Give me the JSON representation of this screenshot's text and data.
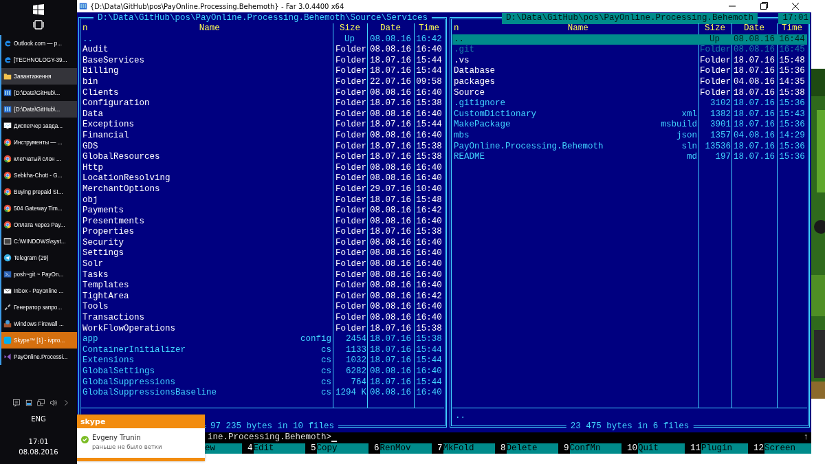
{
  "taskbar": {
    "items": [
      {
        "label": "Outlook.com — p...",
        "kind": "edge",
        "selected": false,
        "attention": false
      },
      {
        "label": "[TECHNOLOGY-39...",
        "kind": "edge",
        "selected": false,
        "attention": false
      },
      {
        "label": "Завантаження",
        "kind": "folder",
        "selected": true,
        "attention": false
      },
      {
        "label": "{D:\\Data\\GitHub\\...",
        "kind": "far",
        "selected": false,
        "attention": false
      },
      {
        "label": "{D:\\Data\\GitHub\\...",
        "kind": "far",
        "selected": true,
        "attention": false
      },
      {
        "label": "Диспетчер завда...",
        "kind": "monitor",
        "selected": false,
        "attention": false
      },
      {
        "label": "Инструменты — ...",
        "kind": "chrome",
        "selected": false,
        "attention": false
      },
      {
        "label": "клетчатый слон ...",
        "kind": "chrome",
        "selected": false,
        "attention": false
      },
      {
        "label": "Sebkha-Chott - G...",
        "kind": "chrome",
        "selected": false,
        "attention": false
      },
      {
        "label": "Buying prepaid SI...",
        "kind": "chrome",
        "selected": false,
        "attention": false
      },
      {
        "label": "504 Gateway Tim...",
        "kind": "chrome",
        "selected": false,
        "attention": false
      },
      {
        "label": "Оплата через Pay...",
        "kind": "chrome",
        "selected": false,
        "attention": false
      },
      {
        "label": "C:\\WINDOWS\\syst...",
        "kind": "cmd",
        "selected": false,
        "attention": false
      },
      {
        "label": "Telegram (29)",
        "kind": "telegram",
        "selected": false,
        "attention": false
      },
      {
        "label": "posh~git ~ PayOn...",
        "kind": "shell",
        "selected": false,
        "attention": false
      },
      {
        "label": "Inbox - Payonline ...",
        "kind": "mail",
        "selected": false,
        "attention": false
      },
      {
        "label": "Генератор запро...",
        "kind": "link",
        "selected": false,
        "attention": false
      },
      {
        "label": "Windows Firewall ...",
        "kind": "firewall",
        "selected": false,
        "attention": false
      },
      {
        "label": "Skype™ [1] - ivpro...",
        "kind": "skype",
        "selected": false,
        "attention": true
      },
      {
        "label": "PayOnline.Processi...",
        "kind": "vs",
        "selected": false,
        "attention": false
      }
    ],
    "tray": {
      "language": "ENG",
      "time": "17:01",
      "date": "08.08.2016"
    }
  },
  "window": {
    "title": "{D:\\Data\\GitHub\\pos\\PayOnline.Processing.Behemoth} - Far 3.0.4400 x64"
  },
  "panels": [
    {
      "active": false,
      "path": "D:\\Data\\GitHub\\pos\\PayOnline.Processing.Behemoth\\Source\\Services",
      "sort": "n",
      "columns": [
        "Name",
        "Size",
        "Date",
        "Time"
      ],
      "footer": "97 235 bytes in 10 files",
      "rows": [
        {
          "name": "..",
          "size": "Up",
          "date": "08.08.16",
          "time": "16:42",
          "kind": "up",
          "selected": false
        },
        {
          "name": "Audit",
          "size": "Folder",
          "date": "08.08.16",
          "time": "16:40",
          "kind": "folder",
          "selected": false
        },
        {
          "name": "BaseServices",
          "size": "Folder",
          "date": "18.07.16",
          "time": "15:44",
          "kind": "folder",
          "selected": false
        },
        {
          "name": "Billing",
          "size": "Folder",
          "date": "18.07.16",
          "time": "15:44",
          "kind": "folder",
          "selected": false
        },
        {
          "name": "bin",
          "size": "Folder",
          "date": "22.07.16",
          "time": "09:58",
          "kind": "folder",
          "selected": false
        },
        {
          "name": "Clients",
          "size": "Folder",
          "date": "08.08.16",
          "time": "16:40",
          "kind": "folder",
          "selected": false
        },
        {
          "name": "Configuration",
          "size": "Folder",
          "date": "18.07.16",
          "time": "15:38",
          "kind": "folder",
          "selected": false
        },
        {
          "name": "Data",
          "size": "Folder",
          "date": "08.08.16",
          "time": "16:40",
          "kind": "folder",
          "selected": false
        },
        {
          "name": "Exceptions",
          "size": "Folder",
          "date": "18.07.16",
          "time": "15:44",
          "kind": "folder",
          "selected": false
        },
        {
          "name": "Financial",
          "size": "Folder",
          "date": "08.08.16",
          "time": "16:40",
          "kind": "folder",
          "selected": false
        },
        {
          "name": "GDS",
          "size": "Folder",
          "date": "18.07.16",
          "time": "15:38",
          "kind": "folder",
          "selected": false
        },
        {
          "name": "GlobalResources",
          "size": "Folder",
          "date": "18.07.16",
          "time": "15:38",
          "kind": "folder",
          "selected": false
        },
        {
          "name": "Http",
          "size": "Folder",
          "date": "08.08.16",
          "time": "16:40",
          "kind": "folder",
          "selected": false
        },
        {
          "name": "LocationResolving",
          "size": "Folder",
          "date": "08.08.16",
          "time": "16:40",
          "kind": "folder",
          "selected": false
        },
        {
          "name": "MerchantOptions",
          "size": "Folder",
          "date": "29.07.16",
          "time": "10:40",
          "kind": "folder",
          "selected": false
        },
        {
          "name": "obj",
          "size": "Folder",
          "date": "18.07.16",
          "time": "15:48",
          "kind": "folder",
          "selected": false
        },
        {
          "name": "Payments",
          "size": "Folder",
          "date": "08.08.16",
          "time": "16:42",
          "kind": "folder",
          "selected": false
        },
        {
          "name": "Presentments",
          "size": "Folder",
          "date": "08.08.16",
          "time": "16:40",
          "kind": "folder",
          "selected": false
        },
        {
          "name": "Properties",
          "size": "Folder",
          "date": "18.07.16",
          "time": "15:38",
          "kind": "folder",
          "selected": false
        },
        {
          "name": "Security",
          "size": "Folder",
          "date": "08.08.16",
          "time": "16:40",
          "kind": "folder",
          "selected": false
        },
        {
          "name": "Settings",
          "size": "Folder",
          "date": "08.08.16",
          "time": "16:40",
          "kind": "folder",
          "selected": false
        },
        {
          "name": "Solr",
          "size": "Folder",
          "date": "08.08.16",
          "time": "16:40",
          "kind": "folder",
          "selected": false
        },
        {
          "name": "Tasks",
          "size": "Folder",
          "date": "08.08.16",
          "time": "16:40",
          "kind": "folder",
          "selected": false
        },
        {
          "name": "Templates",
          "size": "Folder",
          "date": "08.08.16",
          "time": "16:40",
          "kind": "folder",
          "selected": false
        },
        {
          "name": "TightArea",
          "size": "Folder",
          "date": "08.08.16",
          "time": "16:42",
          "kind": "folder",
          "selected": false
        },
        {
          "name": "Tools",
          "size": "Folder",
          "date": "08.08.16",
          "time": "16:40",
          "kind": "folder",
          "selected": false
        },
        {
          "name": "Transactions",
          "size": "Folder",
          "date": "08.08.16",
          "time": "16:40",
          "kind": "folder",
          "selected": false
        },
        {
          "name": "WorkFlowOperations",
          "size": "Folder",
          "date": "18.07.16",
          "time": "15:38",
          "kind": "folder",
          "selected": false
        },
        {
          "name": "app",
          "ext": "config",
          "size": "2454",
          "date": "18.07.16",
          "time": "15:38",
          "kind": "file",
          "selected": false
        },
        {
          "name": "ContainerInitializer",
          "ext": "cs",
          "size": "1133",
          "date": "18.07.16",
          "time": "15:44",
          "kind": "file",
          "selected": false
        },
        {
          "name": "Extensions",
          "ext": "cs",
          "size": "1032",
          "date": "18.07.16",
          "time": "15:44",
          "kind": "file",
          "selected": false
        },
        {
          "name": "GlobalSettings",
          "ext": "cs",
          "size": "6282",
          "date": "08.08.16",
          "time": "16:40",
          "kind": "file",
          "selected": false
        },
        {
          "name": "GlobalSuppressions",
          "ext": "cs",
          "size": "764",
          "date": "18.07.16",
          "time": "15:44",
          "kind": "file",
          "selected": false
        },
        {
          "name": "GlobalSuppressionsBaseline",
          "ext": "cs",
          "size": "1294 K",
          "date": "08.08.16",
          "time": "16:40",
          "kind": "file",
          "selected": false
        }
      ]
    },
    {
      "active": true,
      "path": "D:\\Data\\GitHub\\pos\\PayOnline.Processing.Behemoth",
      "clock": "17:01",
      "sort": "n",
      "columns": [
        "Name",
        "Size",
        "Date",
        "Time"
      ],
      "status": "..",
      "footer": "23 475 bytes in 6 files",
      "rows": [
        {
          "name": "..",
          "size": "Up",
          "date": "08.08.16",
          "time": "16:44",
          "kind": "up",
          "selected": true
        },
        {
          "name": ".git",
          "size": "Folder",
          "date": "08.08.16",
          "time": "16:45",
          "kind": "hidden",
          "selected": false
        },
        {
          "name": ".vs",
          "size": "Folder",
          "date": "18.07.16",
          "time": "15:48",
          "kind": "folder",
          "selected": false
        },
        {
          "name": "Database",
          "size": "Folder",
          "date": "18.07.16",
          "time": "15:36",
          "kind": "folder",
          "selected": false
        },
        {
          "name": "packages",
          "size": "Folder",
          "date": "04.08.16",
          "time": "14:35",
          "kind": "folder",
          "selected": false
        },
        {
          "name": "Source",
          "size": "Folder",
          "date": "18.07.16",
          "time": "15:38",
          "kind": "folder",
          "selected": false
        },
        {
          "name": ".gitignore",
          "size": "3102",
          "date": "18.07.16",
          "time": "15:36",
          "kind": "file",
          "selected": false
        },
        {
          "name": "CustomDictionary",
          "ext": "xml",
          "size": "1382",
          "date": "18.07.16",
          "time": "15:43",
          "kind": "file",
          "selected": false
        },
        {
          "name": "MakePackage",
          "ext": "msbuild",
          "size": "3901",
          "date": "18.07.16",
          "time": "15:36",
          "kind": "file",
          "selected": false
        },
        {
          "name": "mbs",
          "ext": "json",
          "size": "1357",
          "date": "04.08.16",
          "time": "14:29",
          "kind": "file",
          "selected": false
        },
        {
          "name": "PayOnline.Processing.Behemoth",
          "ext": "sln",
          "size": "13536",
          "date": "18.07.16",
          "time": "15:36",
          "kind": "file",
          "selected": false
        },
        {
          "name": "README",
          "ext": "md",
          "size": "197",
          "date": "18.07.16",
          "time": "15:36",
          "kind": "file",
          "selected": false
        }
      ]
    }
  ],
  "command_line": {
    "text": "ine.Processing.Behemoth>",
    "scroll_mark": "↑"
  },
  "keybar": [
    {
      "label": "ew"
    },
    {
      "number": "4",
      "label": "Edit"
    },
    {
      "number": "5",
      "label": "Copy"
    },
    {
      "number": "6",
      "label": "RenMov"
    },
    {
      "number": "7",
      "label": "MkFold"
    },
    {
      "number": "8",
      "label": "Delete"
    },
    {
      "number": "9",
      "label": "ConfMn"
    },
    {
      "number": "10",
      "label": "Quit"
    },
    {
      "number": "11",
      "label": "Plugin"
    },
    {
      "number": "12",
      "label": "Screen"
    }
  ],
  "notification": {
    "logo": "skype",
    "sender": "Evgeny Trunin",
    "message": "раньше не было ветки"
  }
}
